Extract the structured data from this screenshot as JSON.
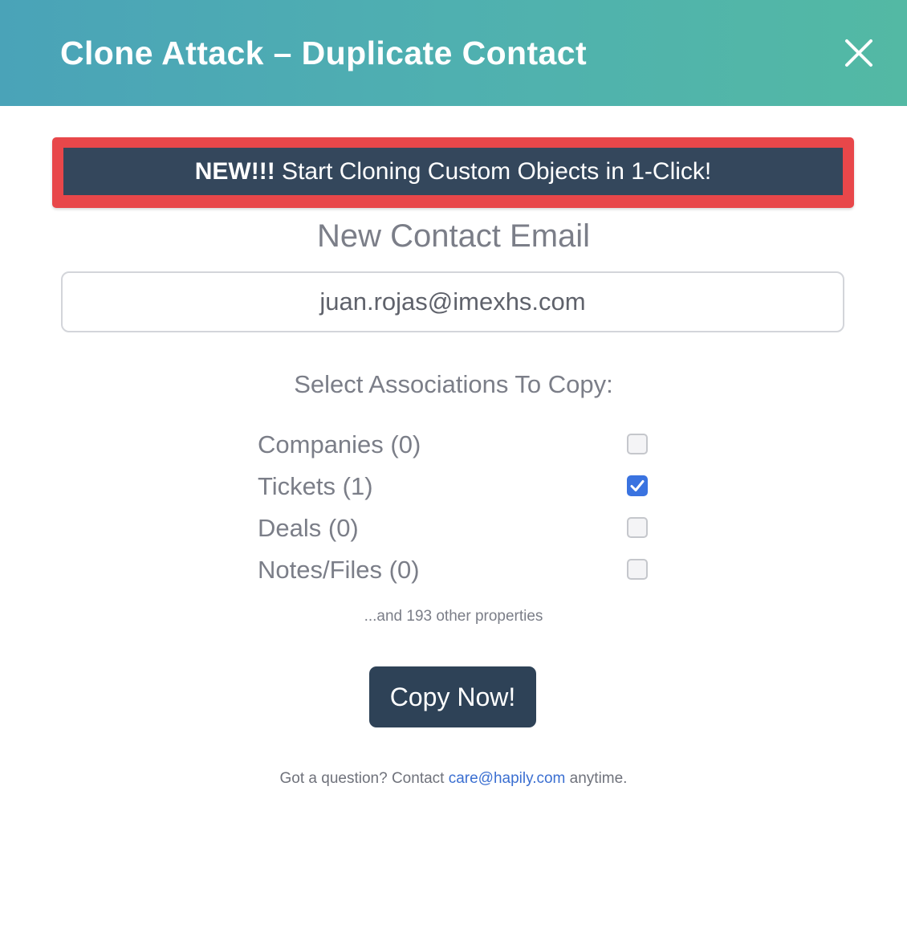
{
  "header": {
    "title": "Clone Attack – Duplicate Contact",
    "close_icon": "close-icon"
  },
  "banner": {
    "prefix": "NEW!!!",
    "text": " Start Cloning Custom Objects in 1-Click!"
  },
  "email": {
    "label": "New Contact Email",
    "value": "juan.rojas@imexhs.com"
  },
  "associations": {
    "title": "Select Associations To Copy:",
    "items": [
      {
        "label": "Companies (0)",
        "checked": false
      },
      {
        "label": "Tickets (1)",
        "checked": true
      },
      {
        "label": "Deals (0)",
        "checked": false
      },
      {
        "label": "Notes/Files (0)",
        "checked": false
      }
    ],
    "other_properties": "...and 193 other properties"
  },
  "actions": {
    "copy_label": "Copy Now!"
  },
  "footer": {
    "prefix": "Got a question? Contact ",
    "link": "care@hapily.com",
    "suffix": " anytime."
  },
  "colors": {
    "header_gradient_start": "#4aa3b8",
    "header_gradient_end": "#53b9a4",
    "banner_border": "#e8474a",
    "banner_fill": "#34475c",
    "button_fill": "#2e4257",
    "checkbox_checked": "#3a73e0",
    "link": "#3b6fd1"
  }
}
